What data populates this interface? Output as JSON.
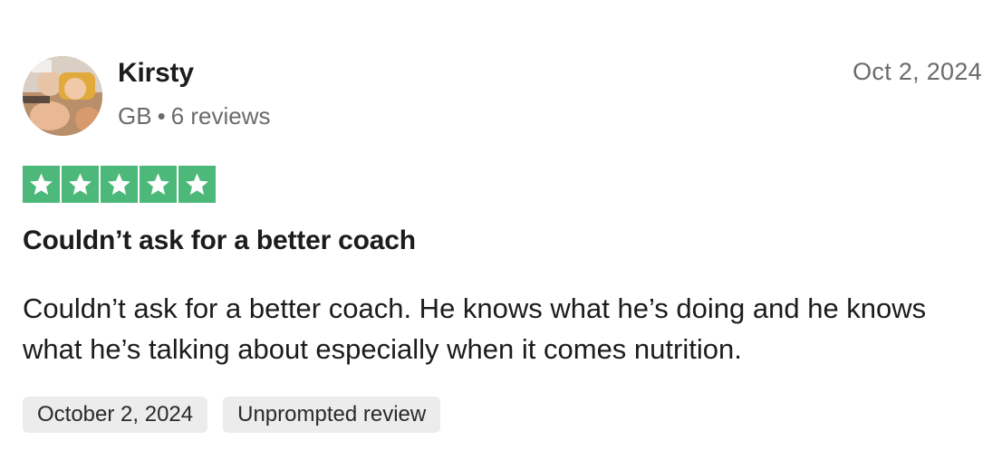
{
  "reviewer": {
    "name": "Kirsty",
    "country": "GB",
    "separator": "•",
    "review_count": "6 reviews",
    "avatar_icon": "profile-photo-icon"
  },
  "review": {
    "date_short": "Oct 2, 2024",
    "rating": 5,
    "rating_max": 5,
    "star_color": "#4cb879",
    "title": "Couldn’t ask for a better coach",
    "body": "Couldn’t ask for a better coach. He knows what he’s doing and he knows what he’s talking about especially when it comes nutrition.",
    "tags": [
      "October 2, 2024",
      "Unprompted review"
    ]
  }
}
